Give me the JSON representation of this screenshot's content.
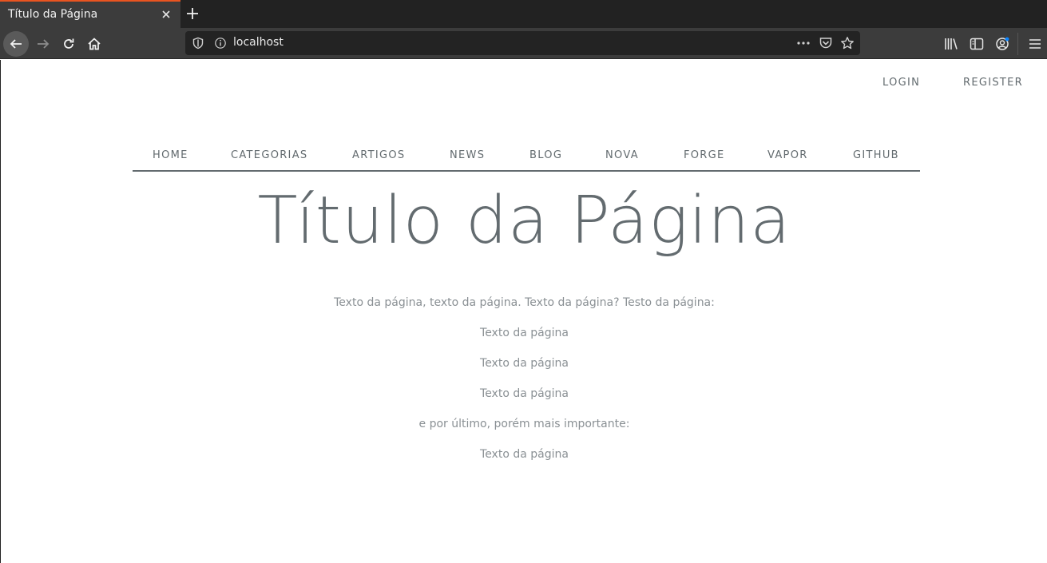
{
  "browser": {
    "tab_title": "Título da Página",
    "url": "localhost",
    "accent_color": "#e95420",
    "icons": {
      "tab_close": "close-icon",
      "new_tab": "plus-icon",
      "back": "arrow-left-icon",
      "forward": "arrow-right-icon",
      "reload": "reload-icon",
      "home": "home-icon",
      "tracking_protection": "shield-icon",
      "site_info": "info-icon",
      "page_actions": "more-icon",
      "pocket": "pocket-icon",
      "bookmark": "star-icon",
      "library": "library-icon",
      "sidebar": "sidebar-icon",
      "account": "account-icon",
      "menu": "hamburger-menu-icon"
    }
  },
  "auth": {
    "login": "LOGIN",
    "register": "REGISTER"
  },
  "nav": {
    "items": [
      "HOME",
      "CATEGORIAS",
      "ARTIGOS",
      "NEWS",
      "BLOG",
      "NOVA",
      "FORGE",
      "VAPOR",
      "GITHUB"
    ]
  },
  "page": {
    "title": "Título da Página",
    "text_color": "#636b6f",
    "paragraphs": [
      "Texto da página, texto da página. Texto da página? Testo da página:",
      "Texto da página",
      "Texto da página",
      "Texto da página",
      "e por último, porém mais importante:",
      "Texto da página"
    ]
  }
}
